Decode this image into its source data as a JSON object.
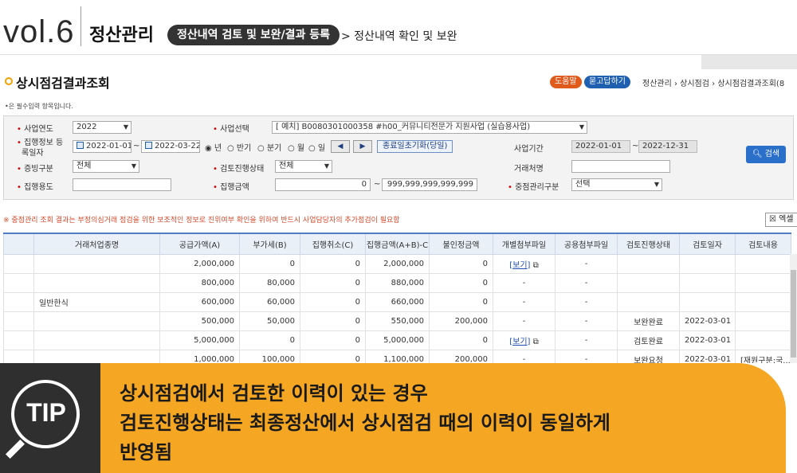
{
  "header": {
    "vol": "vol.6",
    "section": "정산관리",
    "pill": "정산내역 검토 및 보완/결과 등록",
    "crumb_tail": "> 정산내역 확인 및 보완"
  },
  "page": {
    "title": "상시점검결과조회",
    "help_label": "도움말",
    "faq_label": "묻고답하기",
    "breadcrumb": "정산관리 › 상시점검 › 상시점검결과조회(8",
    "required_note": "•은 필수입력 항목입니다."
  },
  "form": {
    "year_label": "사업연도",
    "year_value": "2022",
    "business_label": "사업선택",
    "business_value": "[  예치] B0080301000358 #h00_커뮤니티전문가 지원사업 (실습용사업)",
    "exec_label_1": "집행정보 등",
    "exec_label_2": "록일자",
    "date_from": "2022-01-01",
    "date_to": "2022-03-22",
    "periods": [
      "년",
      "반기",
      "분기",
      "월",
      "일"
    ],
    "prev_btn": "◀",
    "next_btn": "▶",
    "init_btn": "종료일초기화(당일)",
    "term_label": "사업기간",
    "term_from": "2022-01-01",
    "term_to": "2022-12-31",
    "search_btn": "검색",
    "evidence_label": "증빙구분",
    "evidence_value": "전체",
    "review_label": "검토진행상태",
    "review_value": "전체",
    "vendor_label": "거래처명",
    "vendor_value": "",
    "purpose_label": "집행용도",
    "purpose_value": "",
    "amount_label": "집행금액",
    "amount_from": "0",
    "amount_to": "999,999,999,999,999",
    "mgmt_label": "중점관리구분",
    "mgmt_value": "선택"
  },
  "warning": "※ 중점관리 조회 결과는 부정의심거래 점검을 위한 보조적인 정보로 진위여부 확인을 위하여 반드시 사업담당자의 추가점검이 필요함",
  "excel_label": "엑셀",
  "table": {
    "headers": [
      "",
      "거래처업종명",
      "공급가액(A)",
      "부가세(B)",
      "집행취소(C)",
      "집행금액(A+B)-C",
      "불인정금액",
      "개별첨부파일",
      "공용첨부파일",
      "검토진행상태",
      "검토일자",
      "검토내용"
    ],
    "rows": [
      [
        "",
        "",
        "2,000,000",
        "0",
        "0",
        "2,000,000",
        "0",
        "[보기]",
        "-",
        "",
        "",
        ""
      ],
      [
        "",
        "",
        "800,000",
        "80,000",
        "0",
        "880,000",
        "0",
        "-",
        "-",
        "",
        "",
        ""
      ],
      [
        "",
        "일반한식",
        "600,000",
        "60,000",
        "0",
        "660,000",
        "0",
        "-",
        "-",
        "",
        "",
        ""
      ],
      [
        "",
        "",
        "500,000",
        "50,000",
        "0",
        "550,000",
        "200,000",
        "-",
        "-",
        "보완완료",
        "2022-03-01",
        ""
      ],
      [
        "",
        "",
        "5,000,000",
        "0",
        "0",
        "5,000,000",
        "0",
        "[보기]",
        "-",
        "검토완료",
        "2022-03-01",
        ""
      ],
      [
        "",
        "",
        "1,000,000",
        "100,000",
        "0",
        "1,100,000",
        "200,000",
        "-",
        "-",
        "보완요청",
        "2022-03-01",
        "[재원구분:국..."
      ]
    ]
  },
  "tip": {
    "badge": "TIP",
    "line1": "상시점검에서 검토한 이력이 있는 경우",
    "line2": "검토진행상태는 최종정산에서 상시점검 때의 이력이 동일하게",
    "line3": "반영됨"
  }
}
